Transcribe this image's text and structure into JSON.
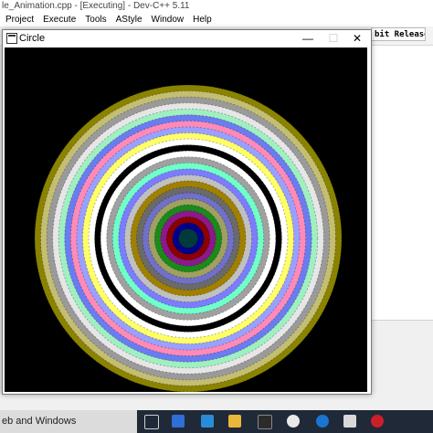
{
  "ide": {
    "title": "le_Animation.cpp - [Executing] - Dev-C++ 5.11",
    "menu": [
      "Project",
      "Execute",
      "Tools",
      "AStyle",
      "Window",
      "Help"
    ],
    "build_config": "bit Release"
  },
  "console": {
    "title": "Circle",
    "minimize": "—",
    "maximize": "☐",
    "close": "✕"
  },
  "artwork": {
    "ring_colors_outer_to_inner": [
      "#8a8300",
      "#c4be72",
      "#9a9a9a",
      "#e6e6e6",
      "#9ff0c0",
      "#6a7cf0",
      "#ff8ab8",
      "#9aa0ff",
      "#ffff66",
      "#ffffff",
      "#000000",
      "#ffffff",
      "#a0a0a0",
      "#70ffc8",
      "#7c7cff",
      "#c0c0c0",
      "#a08000",
      "#6a6a6a",
      "#7070c8",
      "#a0a060",
      "#1a8a1a",
      "#8a1a8a",
      "#8b0000",
      "#00008b",
      "#003a3a"
    ]
  },
  "taskbar": {
    "search_text": "eb and Windows",
    "icons": [
      "task-view-icon",
      "store-icon",
      "vscode-icon",
      "folder-icon",
      "terminal-icon",
      "chrome-icon",
      "edge-icon",
      "media-icon",
      "opera-icon"
    ]
  }
}
